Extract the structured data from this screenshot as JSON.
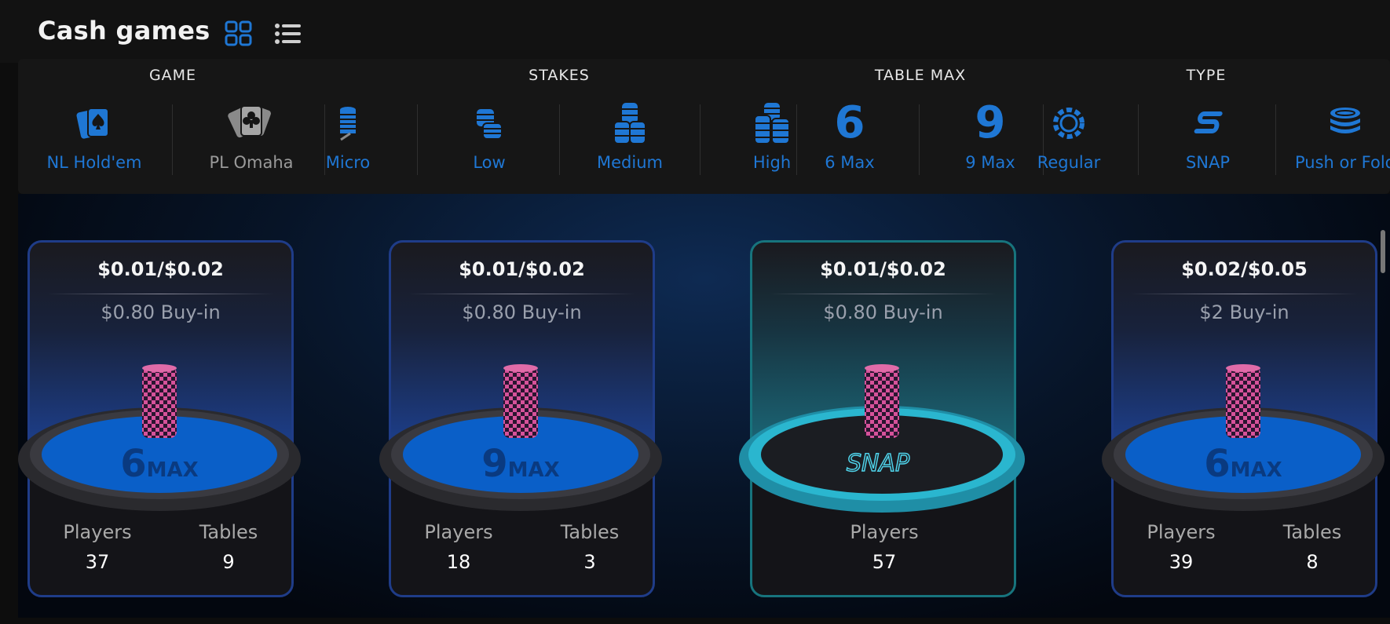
{
  "header": {
    "title": "Cash games",
    "view_grid_icon": "grid-view-icon",
    "view_list_icon": "list-view-icon"
  },
  "filters": {
    "groups": [
      {
        "label": "GAME"
      },
      {
        "label": "STAKES"
      },
      {
        "label": "TABLE MAX"
      },
      {
        "label": "TYPE"
      }
    ],
    "items": [
      {
        "label": "NL Hold'em",
        "icon": "cards-spade-icon",
        "enabled": true
      },
      {
        "label": "PL Omaha",
        "icon": "cards-club-icon",
        "enabled": false
      },
      {
        "label": "Micro",
        "icon": "chip-stack-micro-icon",
        "enabled": true
      },
      {
        "label": "Low",
        "icon": "chip-stack-low-icon",
        "enabled": true
      },
      {
        "label": "Medium",
        "icon": "chip-stack-medium-icon",
        "enabled": true
      },
      {
        "label": "High",
        "icon": "chip-stack-high-icon",
        "enabled": true
      },
      {
        "label": "6 Max",
        "icon": "six-icon",
        "enabled": true
      },
      {
        "label": "9 Max",
        "icon": "nine-icon",
        "enabled": true
      },
      {
        "label": "Regular",
        "icon": "chip-ring-icon",
        "enabled": true
      },
      {
        "label": "SNAP",
        "icon": "snap-s-icon",
        "enabled": true
      },
      {
        "label": "Push or Fold",
        "icon": "chip-pile-icon",
        "enabled": true
      }
    ]
  },
  "cards": [
    {
      "stakes": "$0.01/$0.02",
      "buyin": "$0.80 Buy-in",
      "table_logo_num": "6",
      "table_logo_text": "MAX",
      "players_label": "Players",
      "players": "37",
      "tables_label": "Tables",
      "tables": "9"
    },
    {
      "stakes": "$0.01/$0.02",
      "buyin": "$0.80 Buy-in",
      "table_logo_num": "9",
      "table_logo_text": "MAX",
      "players_label": "Players",
      "players": "18",
      "tables_label": "Tables",
      "tables": "3"
    },
    {
      "stakes": "$0.01/$0.02",
      "buyin": "$0.80 Buy-in",
      "table_logo_text": "SNAP",
      "players_label": "Players",
      "players": "57"
    },
    {
      "stakes": "$0.02/$0.05",
      "buyin": "$2 Buy-in",
      "table_logo_num": "6",
      "table_logo_text": "MAX",
      "players_label": "Players",
      "players": "39",
      "tables_label": "Tables",
      "tables": "8"
    }
  ],
  "colors": {
    "accent": "#1f77d4",
    "felt": "#0a5fc8",
    "snap_rail": "#2ab6cf",
    "chip_pink": "#d6529a"
  }
}
